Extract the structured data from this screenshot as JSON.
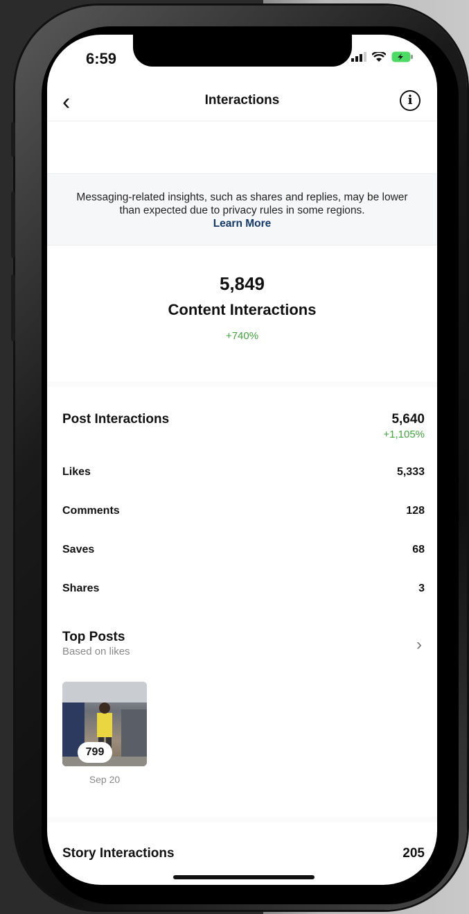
{
  "status": {
    "time": "6:59"
  },
  "nav": {
    "back_icon": "chevron-left-icon",
    "title": "Interactions",
    "info_icon": "info-icon"
  },
  "notice": {
    "text": "Messaging-related insights, such as shares and replies, may be lower than expected due to privacy rules in some regions.",
    "link": "Learn More"
  },
  "summary": {
    "value": "5,849",
    "label": "Content Interactions",
    "change": "+740%"
  },
  "post_interactions": {
    "title": "Post Interactions",
    "value": "5,640",
    "change": "+1,105%",
    "rows": [
      {
        "label": "Likes",
        "value": "5,333"
      },
      {
        "label": "Comments",
        "value": "128"
      },
      {
        "label": "Saves",
        "value": "68"
      },
      {
        "label": "Shares",
        "value": "3"
      }
    ]
  },
  "top_posts": {
    "title": "Top Posts",
    "subtitle": "Based on likes",
    "items": [
      {
        "count": "799",
        "date": "Sep 20"
      }
    ]
  },
  "story_interactions": {
    "title": "Story Interactions",
    "value": "205"
  },
  "colors": {
    "positive": "#3fa53a",
    "link": "#143a6b"
  }
}
